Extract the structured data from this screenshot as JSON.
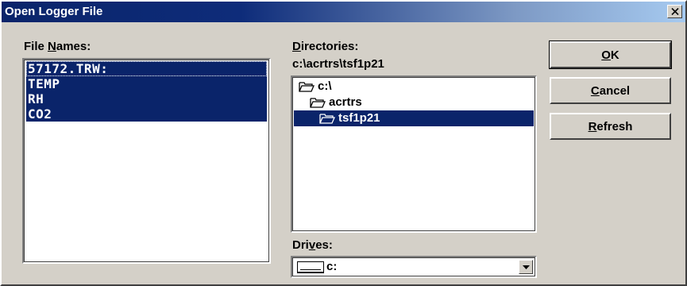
{
  "window": {
    "title": "Open Logger File"
  },
  "file_names": {
    "label_pre": "File ",
    "label_accel": "N",
    "label_post": "ames:",
    "items": [
      "57172.TRW:",
      " TEMP",
      " RH",
      " CO2"
    ]
  },
  "directories": {
    "label_accel": "D",
    "label_post": "irectories:",
    "current_path": "c:\\acrtrs\\tsf1p21",
    "items": [
      "c:\\",
      "acrtrs",
      "tsf1p21"
    ]
  },
  "drives": {
    "label_pre": "Dri",
    "label_accel": "v",
    "label_post": "es:",
    "selected": "c:"
  },
  "buttons": {
    "ok": {
      "accel": "O",
      "rest": "K"
    },
    "cancel": {
      "accel": "C",
      "rest": "ancel"
    },
    "refresh": {
      "accel": "R",
      "rest": "efresh"
    }
  },
  "colors": {
    "selection": "#0a246a",
    "dialog_bg": "#d4d0c8"
  },
  "icons": [
    "close-icon",
    "folder-open-icon",
    "drive-icon",
    "dropdown-arrow-icon"
  ]
}
